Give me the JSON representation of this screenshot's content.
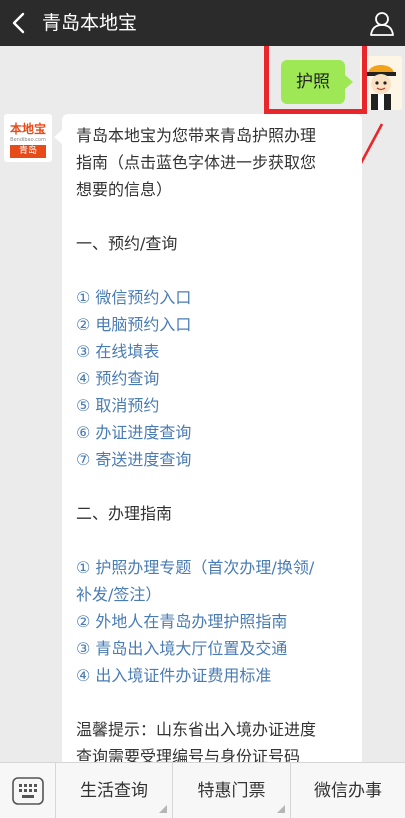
{
  "header": {
    "title": "青岛本地宝",
    "back_icon": "chevron-left-icon",
    "profile_icon": "person-icon"
  },
  "outgoing": {
    "text": "护照"
  },
  "incoming": {
    "avatar": {
      "logo_text": "本地宝",
      "logo_sub": "Bendibao.com",
      "city": "青岛"
    },
    "lines": [
      {
        "text": "青岛本地宝为您带来青岛护照办理",
        "link": false
      },
      {
        "text": "指南（点击蓝色字体进一步获取您",
        "link": false
      },
      {
        "text": "想要的信息）",
        "link": false
      },
      {
        "text": "",
        "link": false
      },
      {
        "text": "一、预约/查询",
        "link": false
      },
      {
        "text": "",
        "link": false
      },
      {
        "text": "① 微信预约入口",
        "link": true
      },
      {
        "text": "② 电脑预约入口",
        "link": true
      },
      {
        "text": "③ 在线填表",
        "link": true
      },
      {
        "text": "④ 预约查询",
        "link": true
      },
      {
        "text": "⑤ 取消预约",
        "link": true
      },
      {
        "text": "⑥ 办证进度查询",
        "link": true
      },
      {
        "text": "⑦ 寄送进度查询",
        "link": true
      },
      {
        "text": "",
        "link": false
      },
      {
        "text": "二、办理指南",
        "link": false
      },
      {
        "text": "",
        "link": false
      },
      {
        "text": "① 护照办理专题（首次办理/换领/",
        "link": true
      },
      {
        "text": "补发/签注）",
        "link": true
      },
      {
        "text": "② 外地人在青岛办理护照指南",
        "link": true
      },
      {
        "text": "③ 青岛出入境大厅位置及交通",
        "link": true
      },
      {
        "text": "④ 出入境证件办证费用标准",
        "link": true
      },
      {
        "text": "",
        "link": false
      },
      {
        "text": "温馨提示：山东省出入境办证进度",
        "link": false
      },
      {
        "text": "查询需要受理编号与身份证号码",
        "link": false
      }
    ]
  },
  "bottom_menu": {
    "keyboard_icon": "keyboard-icon",
    "items": [
      "生活查询",
      "特惠门票",
      "微信办事"
    ]
  },
  "colors": {
    "topbar": "#2b2b2b",
    "outgoing_bubble": "#9fe855",
    "link": "#4a7cb4",
    "annotation": "#e8262b",
    "brand": "#e84b1a"
  }
}
